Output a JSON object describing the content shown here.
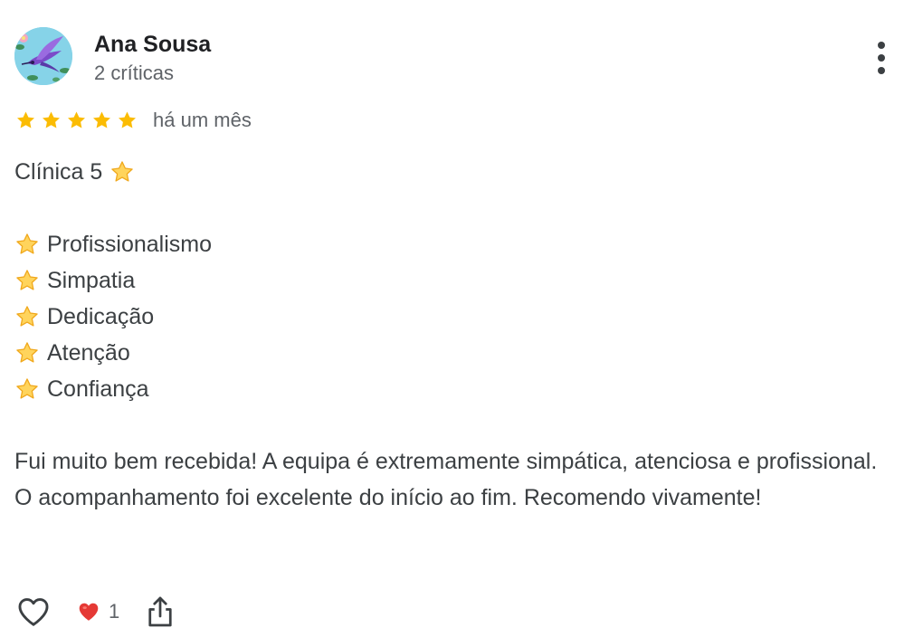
{
  "author": {
    "name": "Ana Sousa",
    "meta": "2 críticas",
    "avatar_icon": "hummingbird-avatar"
  },
  "rating": {
    "stars": 5,
    "max": 5,
    "date": "há um mês",
    "star_color": "#fbbc04"
  },
  "review": {
    "title": "Clínica 5",
    "qualities": [
      "Profissionalismo",
      "Simpatia",
      "Dedicação",
      "Atenção",
      "Confiança"
    ],
    "paragraph": "Fui muito bem recebida! A equipa é extremamente simpática, atenciosa e profissional. O acompanhamento foi excelente do início ao fim. Recomendo vivamente!"
  },
  "actions": {
    "like_icon": "heart-outline-icon",
    "reaction_icon": "red-heart-icon",
    "reaction_count": "1",
    "share_icon": "share-icon"
  },
  "colors": {
    "text": "#3c4043",
    "secondary": "#5f6368",
    "heart": "#e53935"
  }
}
